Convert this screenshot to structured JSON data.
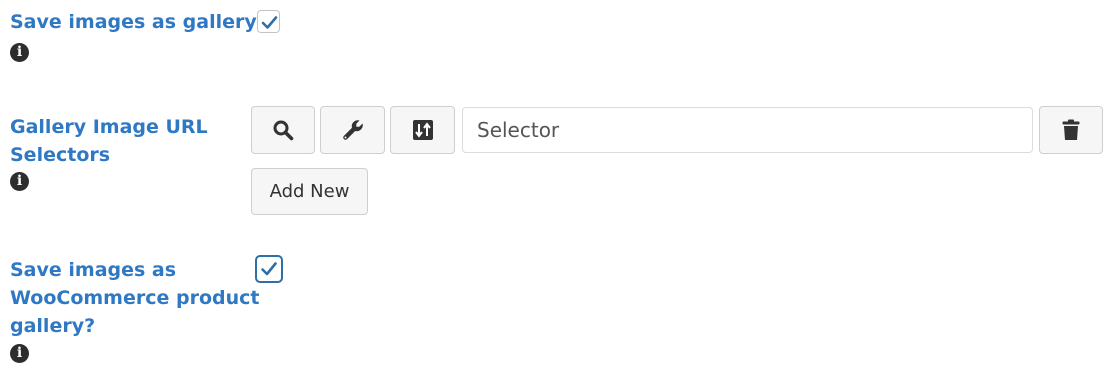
{
  "settings": [
    {
      "label": "Save images as gallery?",
      "info": "i",
      "checked": true
    },
    {
      "label_lines": [
        "Gallery Image URL",
        "Selectors"
      ],
      "info": "i",
      "selector_placeholder": "Selector",
      "add_new_label": "Add New",
      "icons": [
        "search-icon",
        "wrench-icon",
        "sort-numeric-icon",
        "trash-icon"
      ]
    },
    {
      "label_lines": [
        "Save images as",
        "WooCommerce product",
        "gallery?"
      ],
      "info": "i",
      "checked": true
    }
  ],
  "colors": {
    "label": "#2f78c4",
    "check": "#2f6fa8",
    "button_bg": "#f6f6f6"
  }
}
